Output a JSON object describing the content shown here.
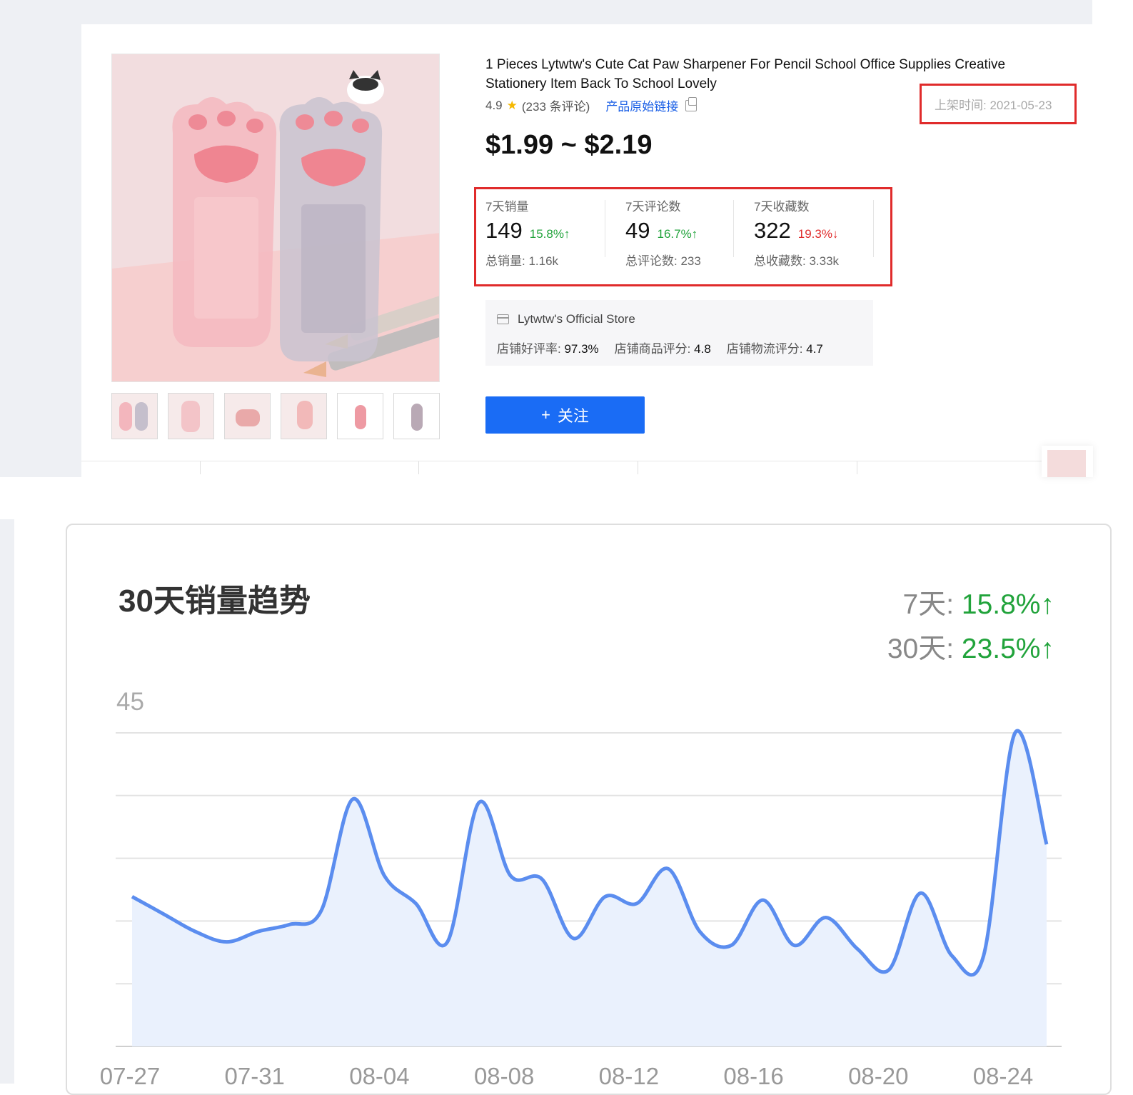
{
  "product": {
    "title": "1 Pieces Lytwtw's Cute Cat Paw Sharpener For Pencil School Office Supplies Creative Stationery Item Back To School Lovely",
    "rating": "4.9",
    "reviews": "(233 条评论)",
    "original_link": "产品原始链接",
    "listing_date": "上架时间: 2021-05-23",
    "price": "$1.99 ~ $2.19",
    "follow_button": "关注",
    "follow_icon": "+",
    "thumbnail_count": 6
  },
  "stats": [
    {
      "label": "7天销量",
      "value": "149",
      "change": "15.8%↑",
      "direction": "up",
      "total": "总销量: 1.16k"
    },
    {
      "label": "7天评论数",
      "value": "49",
      "change": "16.7%↑",
      "direction": "up",
      "total": "总评论数: 233"
    },
    {
      "label": "7天收藏数",
      "value": "322",
      "change": "19.3%↓",
      "direction": "down",
      "total": "总收藏数: 3.33k"
    }
  ],
  "store": {
    "name": "Lytwtw's Official Store",
    "positive_rate_label": "店铺好评率:",
    "positive_rate": "97.3%",
    "product_score_label": "店铺商品评分:",
    "product_score": "4.8",
    "logistics_score_label": "店铺物流评分:",
    "logistics_score": "4.7"
  },
  "trend": {
    "title": "30天销量趋势",
    "change_7d_label": "7天: ",
    "change_7d": "15.8%↑",
    "change_30d_label": "30天: ",
    "change_30d": "23.5%↑"
  },
  "colors": {
    "accent_blue": "#1a6cf5",
    "up_green": "#21a33b",
    "down_red": "#e02b2b",
    "line_blue": "#5b8def",
    "fill_blue": "#eaf1fd"
  },
  "chart_data": {
    "type": "area",
    "title": "30天销量趋势",
    "ylim": [
      0,
      45
    ],
    "y_tick_labels": [
      "45"
    ],
    "grid": true,
    "gridline_count": 5,
    "x_tick_labels": [
      "07-27",
      "07-31",
      "08-04",
      "08-08",
      "08-12",
      "08-16",
      "08-20",
      "08-24"
    ],
    "x": [
      "07-27",
      "07-28",
      "07-29",
      "07-30",
      "07-31",
      "08-01",
      "08-02",
      "08-03",
      "08-04",
      "08-05",
      "08-06",
      "08-07",
      "08-08",
      "08-09",
      "08-10",
      "08-11",
      "08-12",
      "08-13",
      "08-14",
      "08-15",
      "08-16",
      "08-17",
      "08-18",
      "08-19",
      "08-20",
      "08-21",
      "08-22",
      "08-23",
      "08-24",
      "08-25"
    ],
    "values": [
      21.5,
      19,
      16.5,
      15,
      16.5,
      17.5,
      19.5,
      35.5,
      24.5,
      20.5,
      15,
      35,
      24.5,
      24,
      15.5,
      21.5,
      20.5,
      25.5,
      16.5,
      14.5,
      21,
      14.5,
      18.5,
      14,
      11,
      22,
      13,
      13,
      45,
      29
    ]
  }
}
